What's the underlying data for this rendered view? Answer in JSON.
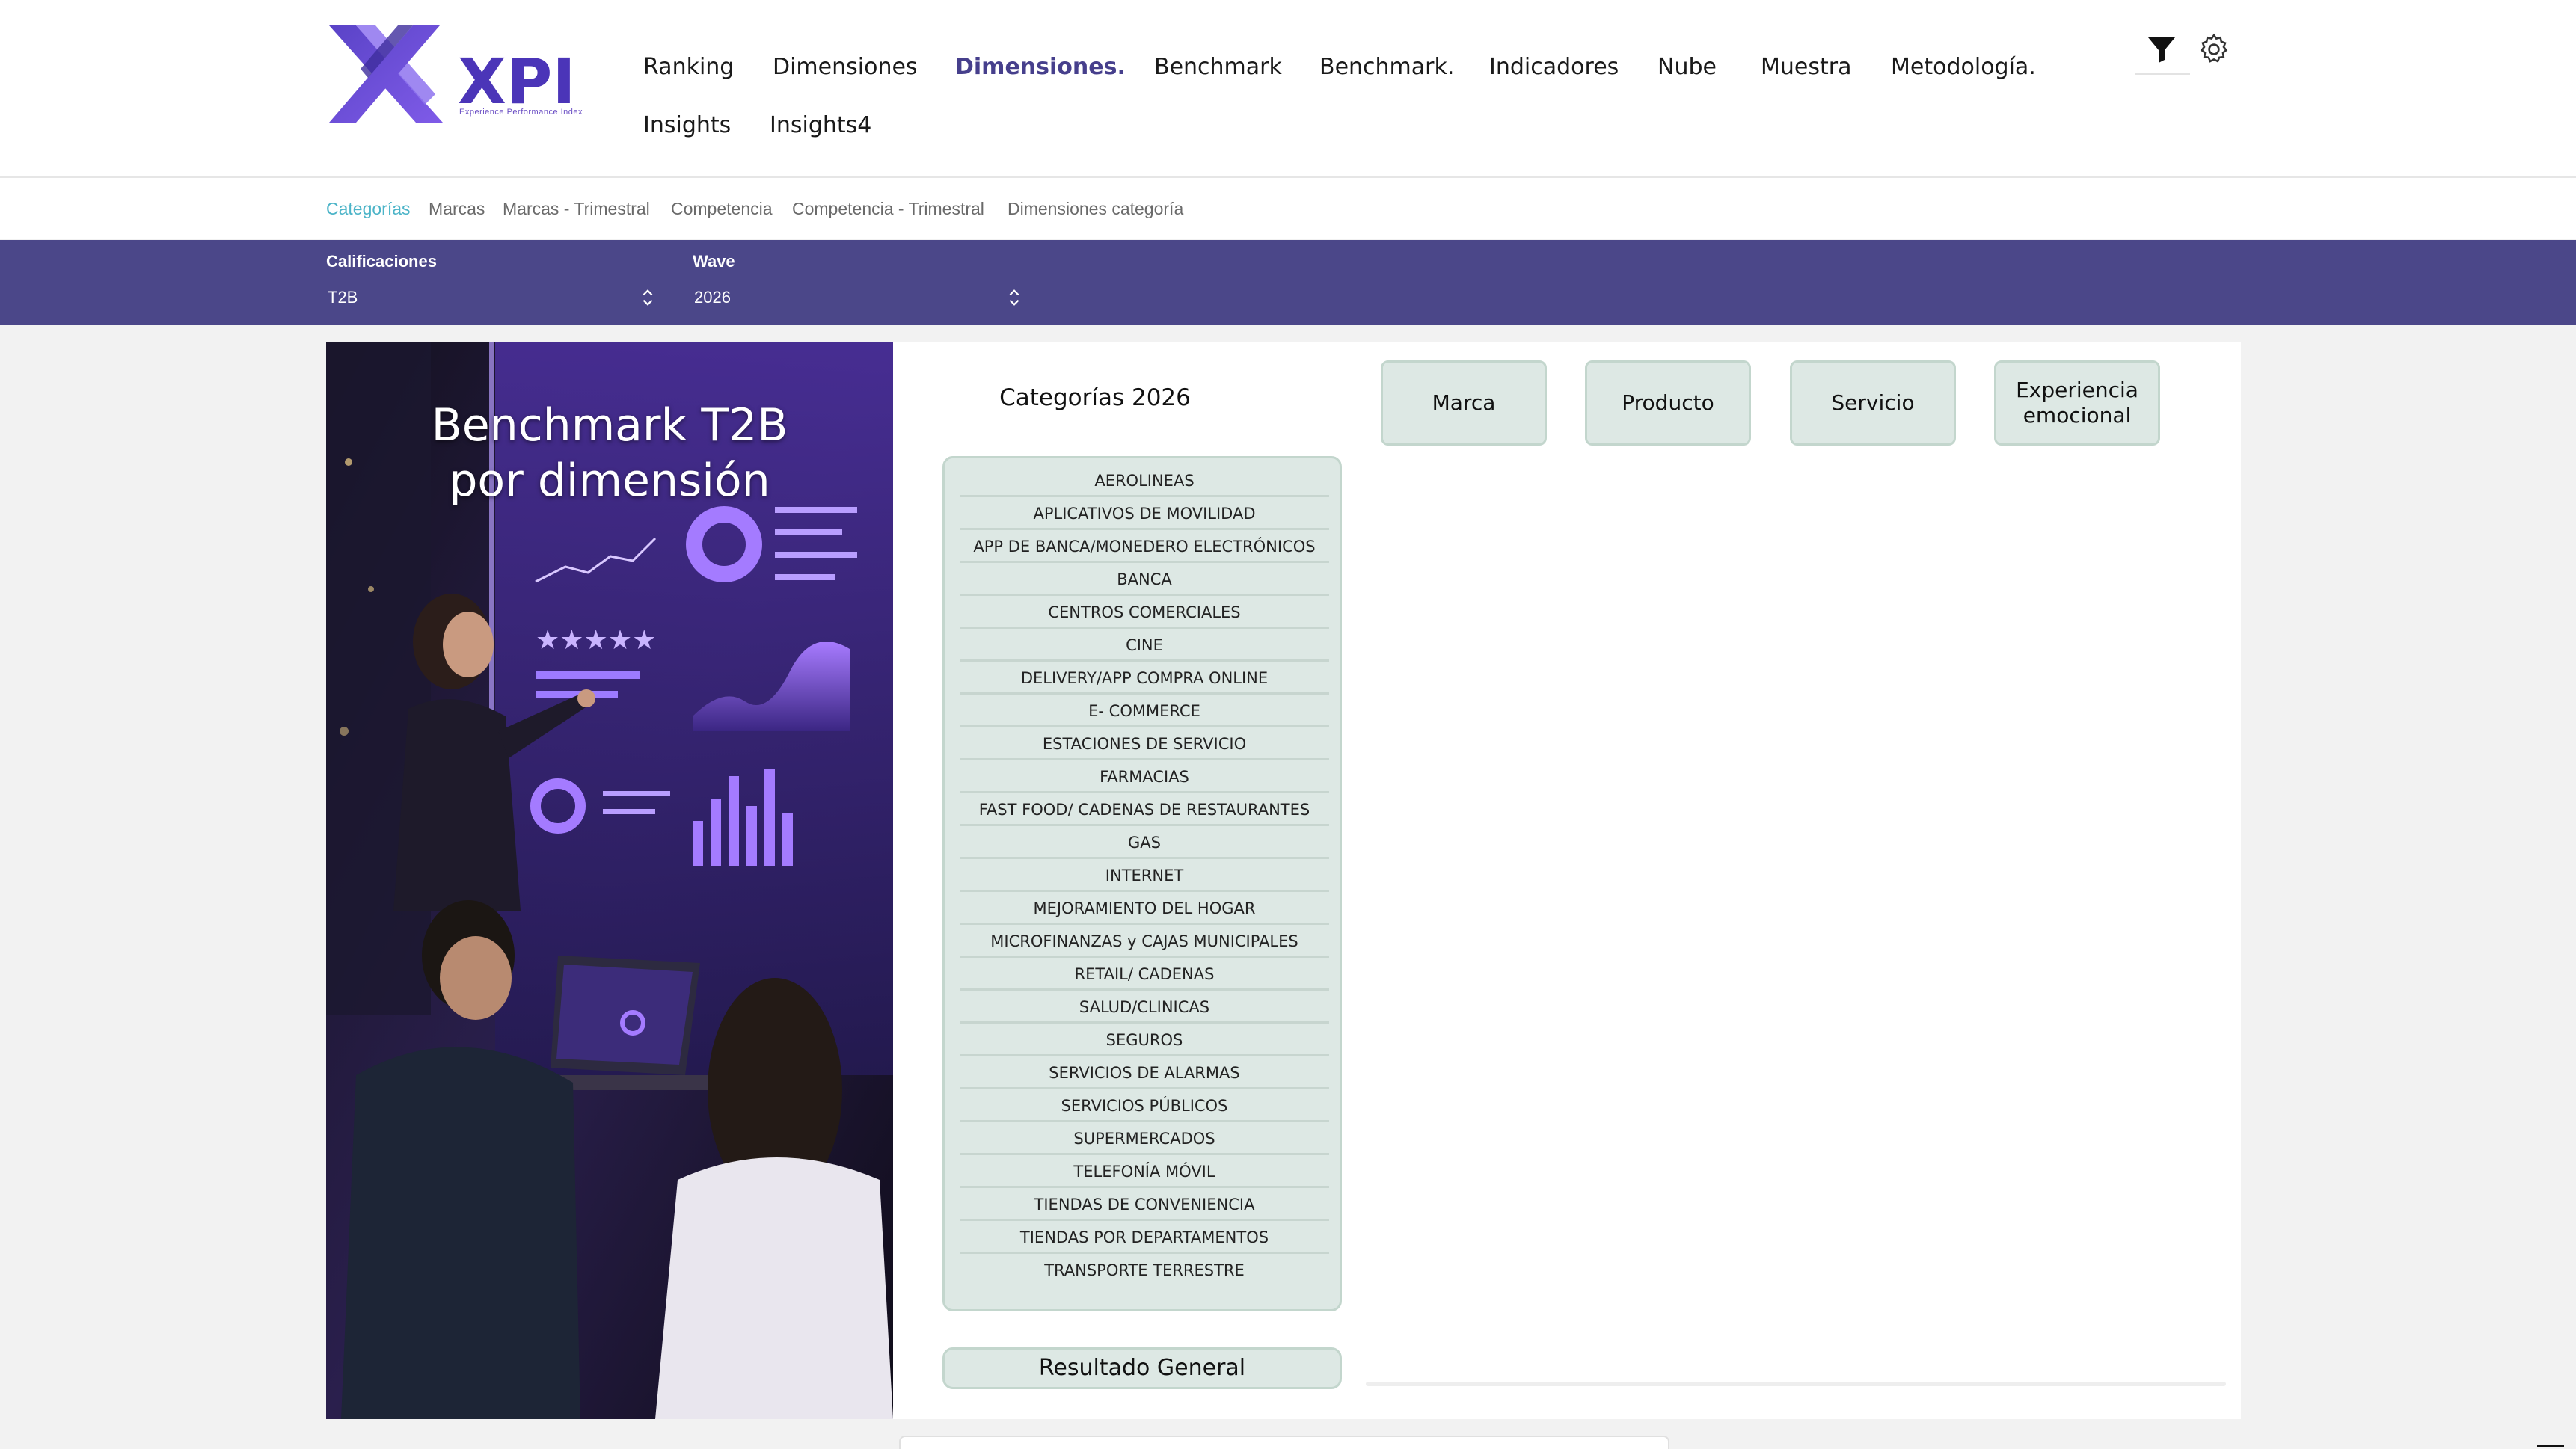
{
  "brand": {
    "name": "XPI",
    "tagline": "Experience Performance Index",
    "primary_color": "#4b4789",
    "accent_color": "#4cb4c8"
  },
  "nav": {
    "items": [
      {
        "label": "Ranking",
        "active": false
      },
      {
        "label": "Dimensiones",
        "active": false
      },
      {
        "label": "Dimensiones.",
        "active": true
      },
      {
        "label": "Benchmark",
        "active": false
      },
      {
        "label": "Benchmark.",
        "active": false
      },
      {
        "label": "Indicadores",
        "active": false
      },
      {
        "label": "Nube",
        "active": false
      },
      {
        "label": "Muestra",
        "active": false
      },
      {
        "label": "Metodología.",
        "active": false
      },
      {
        "label": "Insights",
        "active": false
      },
      {
        "label": "Insights4",
        "active": false
      }
    ],
    "icons": [
      "filter-icon",
      "gear-icon"
    ]
  },
  "subnav": {
    "items": [
      {
        "label": "Categorías",
        "active": true
      },
      {
        "label": "Marcas",
        "active": false
      },
      {
        "label": "Marcas - Trimestral",
        "active": false
      },
      {
        "label": "Competencia",
        "active": false
      },
      {
        "label": "Competencia - Trimestral",
        "active": false
      },
      {
        "label": "Dimensiones categoría",
        "active": false
      }
    ]
  },
  "filters": {
    "calificaciones": {
      "label": "Calificaciones",
      "value": "T2B"
    },
    "wave": {
      "label": "Wave",
      "value": "2026"
    }
  },
  "hero": {
    "title_line1": "Benchmark T2B",
    "title_line2": "por dimensión"
  },
  "categories": {
    "title": "Categorías 2026",
    "items": [
      "AEROLINEAS",
      "APLICATIVOS DE MOVILIDAD",
      "APP DE BANCA/MONEDERO ELECTRÓNICOS",
      "BANCA",
      "CENTROS COMERCIALES",
      "CINE",
      "DELIVERY/APP COMPRA ONLINE",
      "E- COMMERCE",
      "ESTACIONES DE SERVICIO",
      "FARMACIAS",
      "FAST FOOD/ CADENAS DE RESTAURANTES",
      "GAS",
      "INTERNET",
      "MEJORAMIENTO DEL HOGAR",
      "MICROFINANZAS y CAJAS MUNICIPALES",
      "RETAIL/ CADENAS",
      "SALUD/CLINICAS",
      "SEGUROS",
      "SERVICIOS DE ALARMAS",
      "SERVICIOS PÚBLICOS",
      "SUPERMERCADOS",
      "TELEFONÍA MÓVIL",
      "TIENDAS DE CONVENIENCIA",
      "TIENDAS POR DEPARTAMENTOS",
      "TRANSPORTE TERRESTRE"
    ],
    "general_button": "Resultado General"
  },
  "dimensions": {
    "buttons": [
      {
        "label": "Marca"
      },
      {
        "label": "Producto"
      },
      {
        "label": "Servicio"
      },
      {
        "label": "Experiencia emocional"
      }
    ]
  }
}
